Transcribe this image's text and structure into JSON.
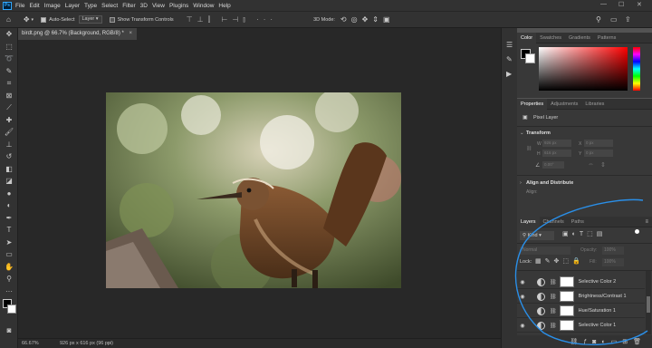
{
  "app": {
    "logo_text": "Ps"
  },
  "menu": [
    "File",
    "Edit",
    "Image",
    "Layer",
    "Type",
    "Select",
    "Filter",
    "3D",
    "View",
    "Plugins",
    "Window",
    "Help"
  ],
  "window_controls": {
    "minimize": "—",
    "maximize": "☐",
    "close": "✕"
  },
  "options_bar": {
    "auto_select_label": "Auto-Select",
    "auto_select_target": "Layer",
    "show_transform_label": "Show Transform Controls",
    "mode_3d_label": "3D Mode:"
  },
  "document": {
    "tab_title": "birdt.png @ 66.7% (Background, RGB/8) *",
    "zoom": "66.67%",
    "doc_info": "926 px x 616 px (96 ppi)"
  },
  "color_panel": {
    "tabs": [
      "Color",
      "Swatches",
      "Gradients",
      "Patterns"
    ],
    "active_tab": "Color",
    "hue_base": "#ff0000"
  },
  "properties_panel": {
    "tabs": [
      "Properties",
      "Adjustments",
      "Libraries"
    ],
    "active_tab": "Properties",
    "layer_type": "Pixel Layer",
    "transform_heading": "Transform",
    "w_label": "W",
    "w_value": "926 px",
    "h_label": "H",
    "h_value": "616 px",
    "x_label": "X",
    "x_value": "0 px",
    "y_label": "Y",
    "y_value": "0 px",
    "angle_value": "0.00°",
    "align_heading": "Align and Distribute",
    "align_sub": "Align:"
  },
  "layers_panel": {
    "tabs": [
      "Layers",
      "Channels",
      "Paths"
    ],
    "active_tab": "Layers",
    "filter_label": "Kind",
    "blend_mode": "Normal",
    "opacity_label": "Opacity:",
    "opacity_value": "100%",
    "lock_label": "Lock:",
    "fill_label": "Fill:",
    "fill_value": "100%",
    "layers": [
      {
        "name": "Selective Color 2",
        "visible": true
      },
      {
        "name": "Brightness/Contrast 1",
        "visible": true
      },
      {
        "name": "Hue/Saturation 1",
        "visible": false
      },
      {
        "name": "Selective Color 1",
        "visible": true
      }
    ]
  },
  "colors": {
    "accent_blue": "#1e88e5",
    "annotation_blue": "#2a8fe8"
  }
}
